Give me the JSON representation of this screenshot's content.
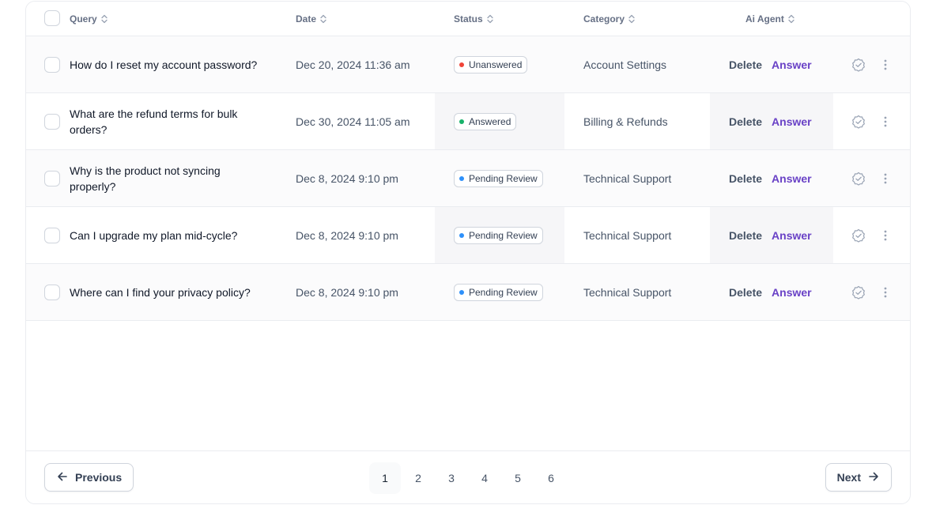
{
  "table": {
    "columns": [
      {
        "label": "Query"
      },
      {
        "label": "Date"
      },
      {
        "label": "Status"
      },
      {
        "label": "Category"
      },
      {
        "label": "Ai Agent"
      }
    ],
    "rows": [
      {
        "query": "How do I reset my account password?",
        "date": "Dec 20, 2024 11:36 am",
        "status": "Unanswered",
        "status_color": "#f04438",
        "category": "Account Settings",
        "delete_label": "Delete",
        "answer_label": "Answer"
      },
      {
        "query": "What are the refund terms for bulk orders?",
        "date": "Dec 30, 2024 11:05 am",
        "status": "Answered",
        "status_color": "#17b26a",
        "category": "Billing & Refunds",
        "delete_label": "Delete",
        "answer_label": "Answer"
      },
      {
        "query": "Why is the product not syncing properly?",
        "date": "Dec 8, 2024 9:10 pm",
        "status": "Pending Review",
        "status_color": "#2e90fa",
        "category": "Technical Support",
        "delete_label": "Delete",
        "answer_label": "Answer"
      },
      {
        "query": "Can I upgrade my plan mid-cycle?",
        "date": "Dec 8, 2024 9:10 pm",
        "status": "Pending Review",
        "status_color": "#2e90fa",
        "category": "Technical Support",
        "delete_label": "Delete",
        "answer_label": "Answer"
      },
      {
        "query": "Where can I find your privacy policy?",
        "date": "Dec 8, 2024 9:10 pm",
        "status": "Pending Review",
        "status_color": "#2e90fa",
        "category": "Technical Support",
        "delete_label": "Delete",
        "answer_label": "Answer"
      }
    ]
  },
  "pagination": {
    "previous_label": "Previous",
    "next_label": "Next",
    "pages": [
      "1",
      "2",
      "3",
      "4",
      "5",
      "6"
    ],
    "current_page": "1"
  },
  "colors": {
    "accent": "#6941c6",
    "border": "#eaecf0"
  }
}
